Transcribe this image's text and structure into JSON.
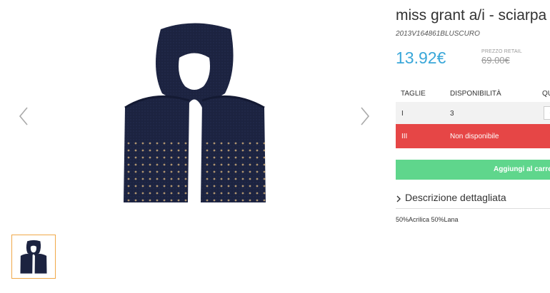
{
  "product": {
    "title": "miss grant a/i - sciarpa",
    "sku": "2013V164861BLUSCURO",
    "price": "13.92€",
    "retail_label": "PREZZO RETAIL",
    "retail_price": "69.00€"
  },
  "table": {
    "headers": [
      "TAGLIE",
      "DISPONIBILITÀ",
      "QU"
    ],
    "rows": [
      {
        "size": "I",
        "availability": "3",
        "qty": "-"
      },
      {
        "size": "III",
        "availability": "Non disponibile"
      }
    ]
  },
  "cart_label": "Aggiungi al carrello",
  "description": {
    "toggle_label": "Descrizione dettagliata",
    "composition": "50%Acrilica 50%Lana"
  },
  "colors": {
    "accent_price": "#3aa7d9",
    "unavailable": "#e64646",
    "cart": "#5fd68c",
    "thumb_border": "#f0a848",
    "product": "#1c2340"
  },
  "icons": [
    "chevron-left-icon",
    "chevron-right-icon",
    "chevron-right-small-icon"
  ]
}
